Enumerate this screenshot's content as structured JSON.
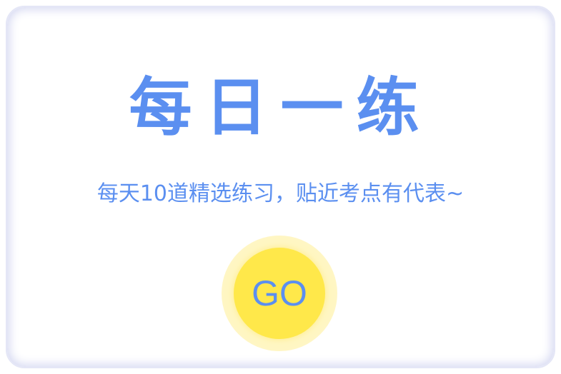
{
  "card": {
    "title": "每日一练",
    "subtitle": "每天10道精选练习，贴近考点有代表~",
    "go_label": "GO"
  },
  "colors": {
    "accent": "#5b8ff0",
    "button": "#ffe84a",
    "border": "#d4d7f1"
  }
}
